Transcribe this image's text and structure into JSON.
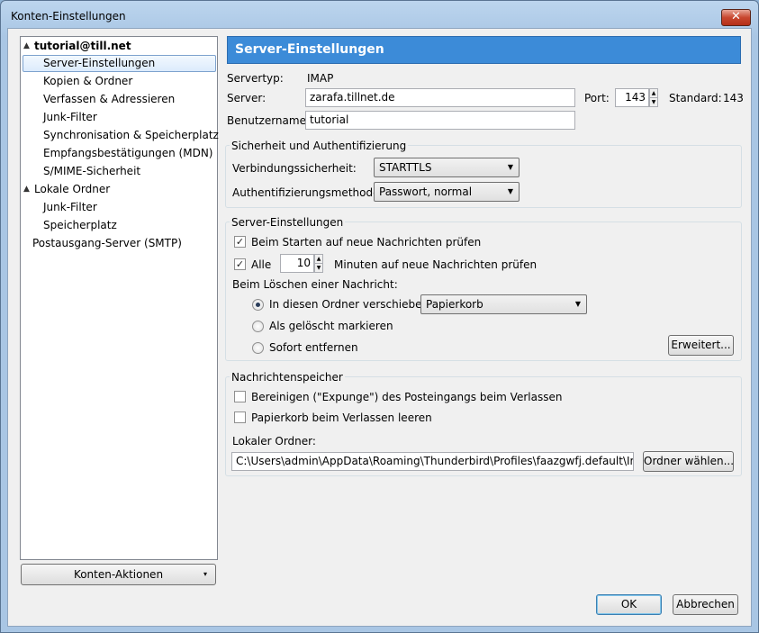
{
  "window": {
    "title": "Konten-Einstellungen",
    "close_symbol": "✕"
  },
  "tree": {
    "items": [
      {
        "label": "tutorial@till.net",
        "level": 0,
        "expanded": true,
        "bold": true
      },
      {
        "label": "Server-Einstellungen",
        "level": 1,
        "selected": true
      },
      {
        "label": "Kopien & Ordner",
        "level": 1
      },
      {
        "label": "Verfassen & Adressieren",
        "level": 1
      },
      {
        "label": "Junk-Filter",
        "level": 1
      },
      {
        "label": "Synchronisation & Speicherplatz",
        "level": 1
      },
      {
        "label": "Empfangsbestätigungen (MDN)",
        "level": 1
      },
      {
        "label": "S/MIME-Sicherheit",
        "level": 1
      },
      {
        "label": "Lokale Ordner",
        "level": 0,
        "expanded": true
      },
      {
        "label": "Junk-Filter",
        "level": 1
      },
      {
        "label": "Speicherplatz",
        "level": 1
      },
      {
        "label": "Postausgang-Server (SMTP)",
        "level": 0
      }
    ],
    "expand_icon": "▲"
  },
  "account_actions": {
    "label": "Konten-Aktionen",
    "arrow": "▾"
  },
  "panel": {
    "header": "Server-Einstellungen",
    "server_type_label": "Servertyp:",
    "server_type_value": "IMAP",
    "server_label": "Server:",
    "server_value": "zarafa.tillnet.de",
    "port_label": "Port:",
    "port_value": "143",
    "standard_label": "Standard:",
    "standard_value": "143",
    "username_label": "Benutzername:",
    "username_value": "tutorial"
  },
  "security": {
    "legend": "Sicherheit und Authentifizierung",
    "conn_label": "Verbindungssicherheit:",
    "conn_value": "STARTTLS",
    "auth_label": "Authentifizierungsmethode:",
    "auth_value": "Passwort, normal"
  },
  "server_settings": {
    "legend": "Server-Einstellungen",
    "check_on_start": {
      "label": "Beim Starten auf neue Nachrichten prüfen",
      "checked": true
    },
    "check_every": {
      "label": "Alle",
      "checked": true,
      "value": "10",
      "suffix": "Minuten auf neue Nachrichten prüfen"
    },
    "on_delete_label": "Beim Löschen einer Nachricht:",
    "move_option": {
      "label": "In diesen Ordner verschieben:",
      "selected": true,
      "folder": "Papierkorb"
    },
    "mark_option": {
      "label": "Als gelöscht markieren",
      "selected": false
    },
    "remove_option": {
      "label": "Sofort entfernen",
      "selected": false
    },
    "advanced_button": "Erweitert..."
  },
  "storage": {
    "legend": "Nachrichtenspeicher",
    "expunge": {
      "label": "Bereinigen (\"Expunge\") des Posteingangs beim Verlassen",
      "checked": false
    },
    "empty_trash": {
      "label": "Papierkorb beim Verlassen leeren",
      "checked": false
    },
    "local_folder_label": "Lokaler Ordner:",
    "local_folder_value": "C:\\Users\\admin\\AppData\\Roaming\\Thunderbird\\Profiles\\faazgwfj.default\\ImapMai",
    "choose_button": "Ordner wählen..."
  },
  "footer": {
    "ok": "OK",
    "cancel": "Abbrechen"
  },
  "icons": {
    "dropdown_arrow": "▼",
    "spin_up": "▲",
    "spin_down": "▼",
    "check_mark": "✓"
  }
}
